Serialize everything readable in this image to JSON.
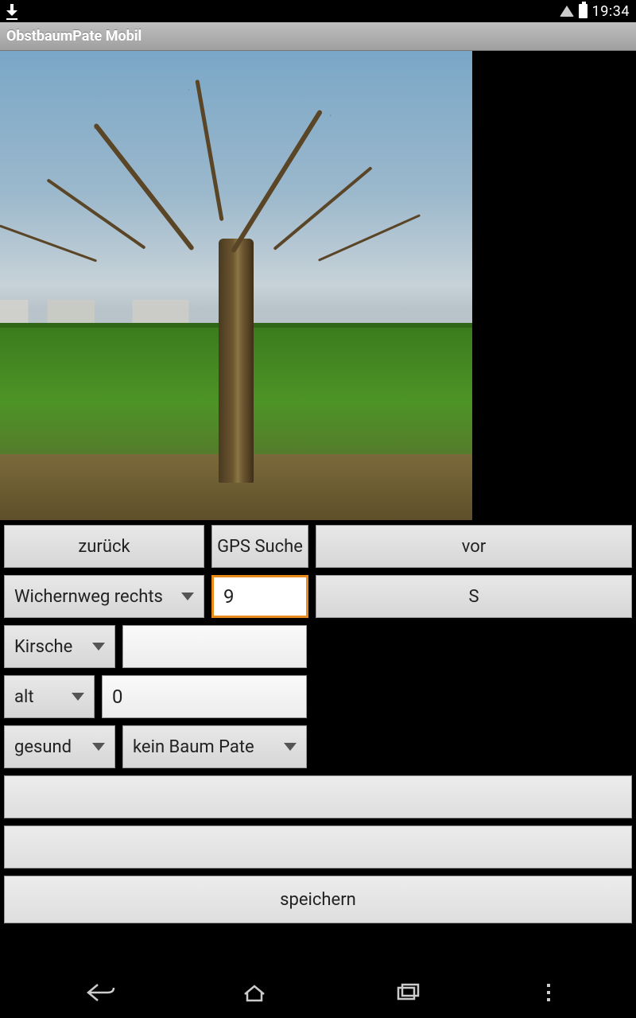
{
  "status": {
    "time": "19:34"
  },
  "title": "ObstbaumPate Mobil",
  "nav": {
    "back_label": "zurück",
    "gps_label": "GPS Suche",
    "forward_label": "vor"
  },
  "row2": {
    "location_value": "Wichernweg rechts",
    "number_value": "9",
    "s_label": "S"
  },
  "row3": {
    "species_value": "Kirsche",
    "variety_value": ""
  },
  "row4": {
    "age_value": "alt",
    "qty_value": "0"
  },
  "row5": {
    "health_value": "gesund",
    "sponsor_value": "kein Baum Pate"
  },
  "note1": "",
  "note2": "",
  "save_label": "speichern"
}
